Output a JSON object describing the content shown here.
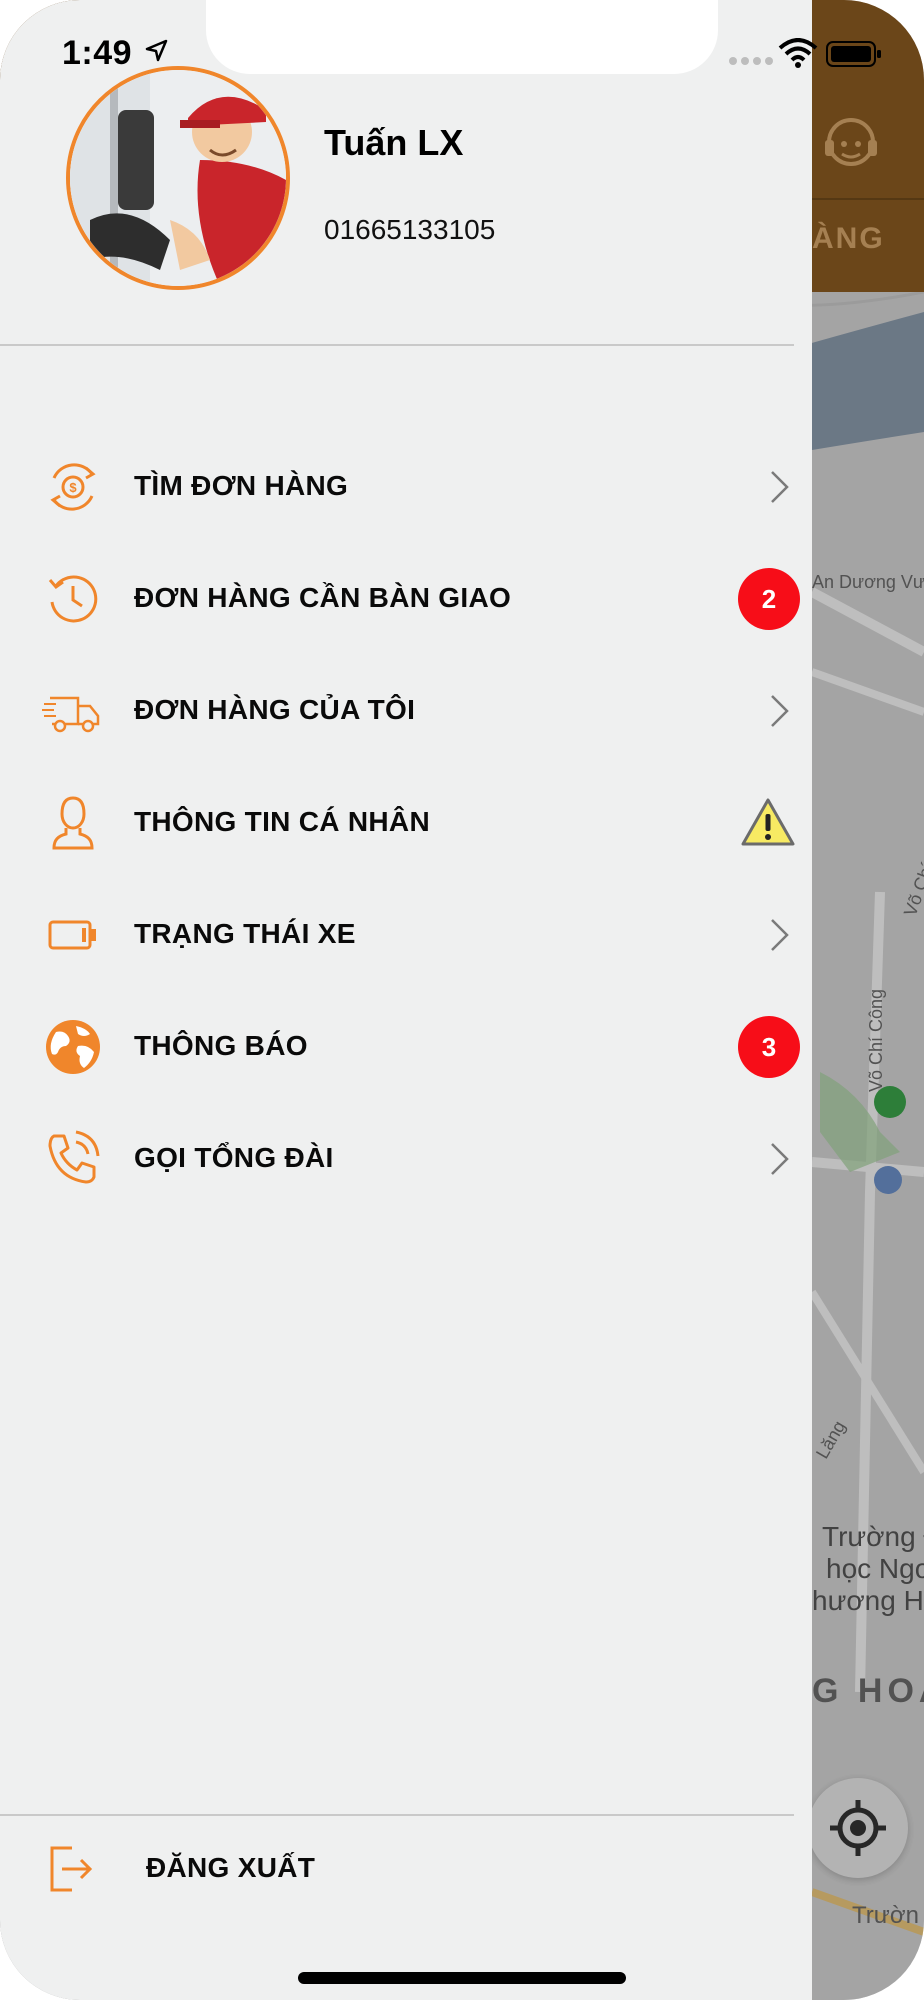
{
  "status_bar": {
    "time": "1:49"
  },
  "profile": {
    "name": "Tuấn LX",
    "phone": "01665133105"
  },
  "menu": [
    {
      "label": "TÌM ĐƠN HÀNG",
      "icon": "money-search-icon",
      "trailing": "chevron"
    },
    {
      "label": "ĐƠN HÀNG CẦN BÀN GIAO",
      "icon": "history-icon",
      "trailing": "badge",
      "badge": "2"
    },
    {
      "label": "ĐƠN HÀNG CỦA TÔI",
      "icon": "delivery-truck-icon",
      "trailing": "chevron"
    },
    {
      "label": "THÔNG TIN CÁ NHÂN",
      "icon": "person-icon",
      "trailing": "warning"
    },
    {
      "label": "TRẠNG THÁI XE",
      "icon": "battery-status-icon",
      "trailing": "chevron"
    },
    {
      "label": "THÔNG BÁO",
      "icon": "globe-icon",
      "trailing": "badge",
      "badge": "3"
    },
    {
      "label": "GỌI TỔNG ĐÀI",
      "icon": "phone-call-icon",
      "trailing": "chevron"
    }
  ],
  "logout": {
    "label": "ĐĂNG XUẤT"
  },
  "background_app": {
    "tab_label": "ÀNG",
    "map_labels": [
      "An Dương Vươ",
      "Võ Chí Công",
      "Võ Chí",
      "Lăng",
      "Trường Đ",
      "học Ngo",
      "hương Hà",
      "G HOÀ",
      "Trườn"
    ]
  },
  "colors": {
    "accent": "#F0862B",
    "badge": "#F70D18",
    "drawer_bg": "#EFF0F0",
    "header_bg": "#8A5A21"
  }
}
